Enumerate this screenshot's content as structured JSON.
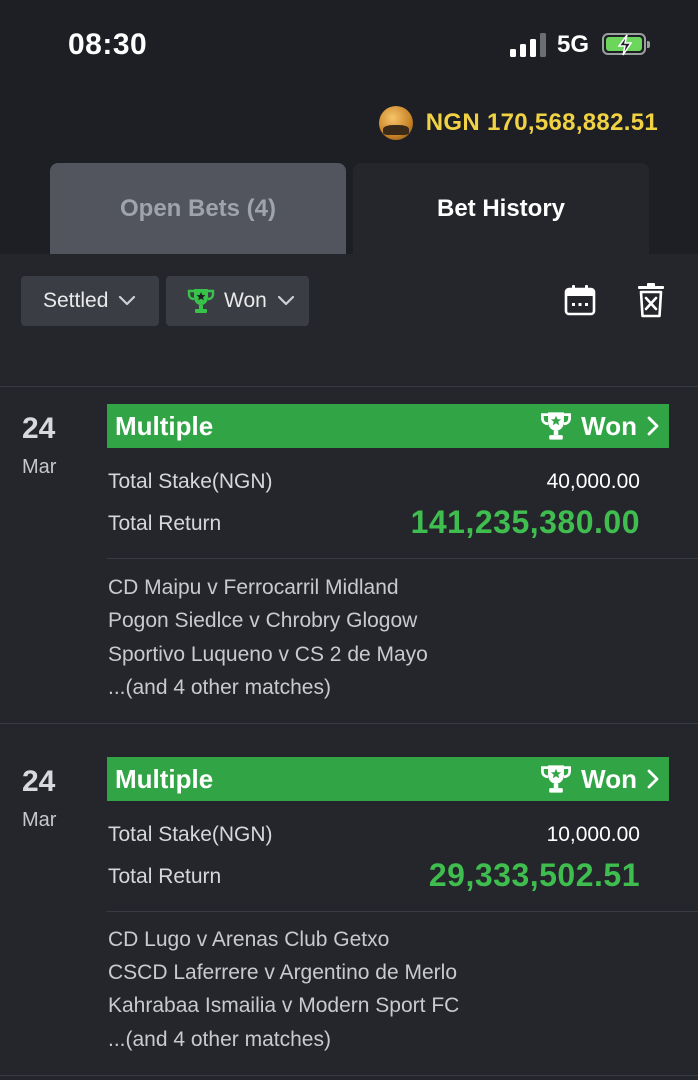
{
  "status_bar": {
    "time": "08:30",
    "network": "5G"
  },
  "balance": {
    "text": "NGN 170,568,882.51"
  },
  "tabs": [
    {
      "label": "Open Bets (4)",
      "active": false
    },
    {
      "label": "Bet History",
      "active": true
    }
  ],
  "filters": {
    "settled_label": "Settled",
    "won_label": "Won"
  },
  "bets": [
    {
      "day": "24",
      "month": "Mar",
      "type": "Multiple",
      "status": "Won",
      "stake_label": "Total Stake(NGN)",
      "stake": "40,000.00",
      "return_label": "Total Return",
      "return": "141,235,380.00",
      "matches": [
        "CD Maipu v Ferrocarril Midland",
        "Pogon Siedlce v Chrobry Glogow",
        "Sportivo Luqueno v CS 2 de Mayo",
        "...(and 4 other matches)"
      ]
    },
    {
      "day": "24",
      "month": "Mar",
      "type": "Multiple",
      "status": "Won",
      "stake_label": "Total Stake(NGN)",
      "stake": "10,000.00",
      "return_label": "Total Return",
      "return": "29,333,502.51",
      "matches": [
        "CD Lugo v Arenas Club Getxo",
        "CSCD Laferrere v Argentino de Merlo",
        "Kahrabaa Ismailia v Modern Sport FC",
        "...(and 4 other matches)"
      ]
    }
  ],
  "colors": {
    "accent_green": "#31a545",
    "return_green": "#3fbe4f",
    "balance_yellow": "#f1d243"
  },
  "icons": [
    "signal-icon",
    "battery-icon",
    "coin-avatar-icon",
    "trophy-icon",
    "chevron-down-icon",
    "calendar-icon",
    "delete-icon",
    "chevron-right-icon"
  ]
}
